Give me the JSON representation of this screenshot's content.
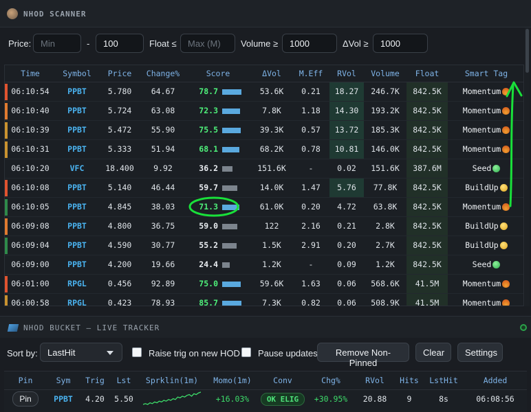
{
  "scanner": {
    "title": "NHOD SCANNER",
    "filters": {
      "price_label": "Price:",
      "price_min_placeholder": "Min",
      "dash": "-",
      "price_max_value": "100",
      "float_label": "Float ≤",
      "float_placeholder": "Max (M)",
      "volume_label": "Volume ≥",
      "volume_value": "1000",
      "dvol_label": "ΔVol ≥",
      "dvol_value": "1000"
    },
    "columns": [
      "Time",
      "Symbol",
      "Price",
      "Change%",
      "Score",
      "ΔVol",
      "M.Eff",
      "RVol",
      "Volume",
      "Float",
      "Smart Tag"
    ],
    "rows": [
      {
        "time": "06:10:54",
        "symbol": "PPBT",
        "price": "5.780",
        "change": "64.67",
        "score": "78.7",
        "score_level": 1.0,
        "score_color": "#4ef07a",
        "bar_color": "#5aa9df",
        "dvol": "53.6K",
        "meff": "0.21",
        "rvol": "18.27",
        "rvol_hl": true,
        "volume": "246.7K",
        "float": "842.5K",
        "tag": "Momentum",
        "tag_icon": "fire-icon",
        "marker": "#e0532f"
      },
      {
        "time": "06:10:40",
        "symbol": "PPBT",
        "price": "5.724",
        "change": "63.08",
        "score": "72.3",
        "score_level": 0.92,
        "score_color": "#4ef07a",
        "bar_color": "#5aa9df",
        "dvol": "7.8K",
        "meff": "1.18",
        "rvol": "14.30",
        "rvol_hl": true,
        "volume": "193.2K",
        "float": "842.5K",
        "tag": "Momentum",
        "tag_icon": "fire-icon",
        "marker": "#e07a2f"
      },
      {
        "time": "06:10:39",
        "symbol": "PPBT",
        "price": "5.472",
        "change": "55.90",
        "score": "75.5",
        "score_level": 0.96,
        "score_color": "#4ef07a",
        "bar_color": "#5aa9df",
        "dvol": "39.3K",
        "meff": "0.57",
        "rvol": "13.72",
        "rvol_hl": true,
        "volume": "185.3K",
        "float": "842.5K",
        "tag": "Momentum",
        "tag_icon": "fire-icon",
        "marker": "#c9922f"
      },
      {
        "time": "06:10:31",
        "symbol": "PPBT",
        "price": "5.333",
        "change": "51.94",
        "score": "68.1",
        "score_level": 0.88,
        "score_color": "#4ef07a",
        "bar_color": "#5aa9df",
        "dvol": "68.2K",
        "meff": "0.78",
        "rvol": "10.81",
        "rvol_hl": true,
        "volume": "146.0K",
        "float": "842.5K",
        "tag": "Momentum",
        "tag_icon": "fire-icon",
        "marker": "#c9922f"
      },
      {
        "time": "06:10:20",
        "symbol": "VFC",
        "price": "18.400",
        "change": "9.92",
        "score": "36.2",
        "score_level": 0.55,
        "score_color": "#e9edf1",
        "bar_color": "#7c848d",
        "dvol": "151.6K",
        "meff": "-",
        "rvol": "0.02",
        "rvol_hl": false,
        "volume": "151.6K",
        "float": "387.6M",
        "tag": "Seed",
        "tag_icon": "seed-icon",
        "marker": ""
      },
      {
        "time": "06:10:08",
        "symbol": "PPBT",
        "price": "5.140",
        "change": "46.44",
        "score": "59.7",
        "score_level": 0.8,
        "score_color": "#e9edf1",
        "bar_color": "#7c848d",
        "dvol": "14.0K",
        "meff": "1.47",
        "rvol": "5.76",
        "rvol_hl": true,
        "volume": "77.8K",
        "float": "842.5K",
        "tag": "BuildUp",
        "tag_icon": "coin-icon",
        "marker": "#e0532f"
      },
      {
        "time": "06:10:05",
        "symbol": "PPBT",
        "price": "4.845",
        "change": "38.03",
        "score": "71.3",
        "score_level": 0.9,
        "score_color": "#4ef07a",
        "bar_color": "#5aa9df",
        "dvol": "61.0K",
        "meff": "0.20",
        "rvol": "4.72",
        "rvol_hl": false,
        "volume": "63.8K",
        "float": "842.5K",
        "tag": "Momentum",
        "tag_icon": "fire-icon",
        "marker": "#2f8a4a"
      },
      {
        "time": "06:09:08",
        "symbol": "PPBT",
        "price": "4.800",
        "change": "36.75",
        "score": "59.0",
        "score_level": 0.8,
        "score_color": "#e9edf1",
        "bar_color": "#7c848d",
        "dvol": "122",
        "meff": "2.16",
        "rvol": "0.21",
        "rvol_hl": false,
        "volume": "2.8K",
        "float": "842.5K",
        "tag": "BuildUp",
        "tag_icon": "coin-icon",
        "marker": "#e07a2f"
      },
      {
        "time": "06:09:04",
        "symbol": "PPBT",
        "price": "4.590",
        "change": "30.77",
        "score": "55.2",
        "score_level": 0.75,
        "score_color": "#e9edf1",
        "bar_color": "#7c848d",
        "dvol": "1.5K",
        "meff": "2.91",
        "rvol": "0.20",
        "rvol_hl": false,
        "volume": "2.7K",
        "float": "842.5K",
        "tag": "BuildUp",
        "tag_icon": "coin-icon",
        "marker": "#2f8a4a"
      },
      {
        "time": "06:09:00",
        "symbol": "PPBT",
        "price": "4.200",
        "change": "19.66",
        "score": "24.4",
        "score_level": 0.4,
        "score_color": "#e9edf1",
        "bar_color": "#7c848d",
        "dvol": "1.2K",
        "meff": "-",
        "rvol": "0.09",
        "rvol_hl": false,
        "volume": "1.2K",
        "float": "842.5K",
        "tag": "Seed",
        "tag_icon": "seed-icon",
        "marker": ""
      },
      {
        "time": "06:01:00",
        "symbol": "RPGL",
        "price": "0.456",
        "change": "92.89",
        "score": "75.0",
        "score_level": 0.96,
        "score_color": "#4ef07a",
        "bar_color": "#5aa9df",
        "dvol": "59.6K",
        "meff": "1.63",
        "rvol": "0.06",
        "rvol_hl": false,
        "volume": "568.6K",
        "float": "41.5M",
        "tag": "Momentum",
        "tag_icon": "fire-icon",
        "marker": "#e0532f"
      },
      {
        "time": "06:00:58",
        "symbol": "RPGL",
        "price": "0.423",
        "change": "78.93",
        "score": "85.7",
        "score_level": 1.0,
        "score_color": "#4ef07a",
        "bar_color": "#5aa9df",
        "dvol": "7.3K",
        "meff": "0.82",
        "rvol": "0.06",
        "rvol_hl": false,
        "volume": "508.9K",
        "float": "41.5M",
        "tag": "Momentum",
        "tag_icon": "fire-icon",
        "marker": "#c9922f"
      }
    ]
  },
  "bucket": {
    "title": "NHOD BUCKET — LIVE TRACKER",
    "sort_label": "Sort by:",
    "sort_value": "LastHit",
    "raise_trig_label": "Raise trig on new HOD",
    "pause_label": "Pause updates",
    "remove_label": "Remove Non-Pinned",
    "clear_label": "Clear",
    "settings_label": "Settings",
    "columns": [
      "Pin",
      "Sym",
      "Trig",
      "Lst",
      "Sprklin(1m)",
      "Momo(1m)",
      "Conv",
      "Chg%",
      "RVol",
      "Hits",
      "LstHit",
      "Added"
    ],
    "rows": [
      {
        "pin": "Pin",
        "sym": "PPBT",
        "trig": "4.20",
        "lst": "5.50",
        "momo": "+16.03%",
        "conv": "OK ELIG",
        "chg": "+30.95%",
        "rvol": "20.88",
        "hits": "9",
        "lsthit": "8s",
        "added": "06:08:56",
        "spark": [
          3,
          4,
          3,
          5,
          4,
          6,
          5,
          7,
          6,
          8,
          7,
          9,
          8,
          10,
          9,
          12,
          11,
          13,
          12,
          14,
          15,
          13,
          16,
          15,
          17,
          18
        ]
      }
    ]
  }
}
